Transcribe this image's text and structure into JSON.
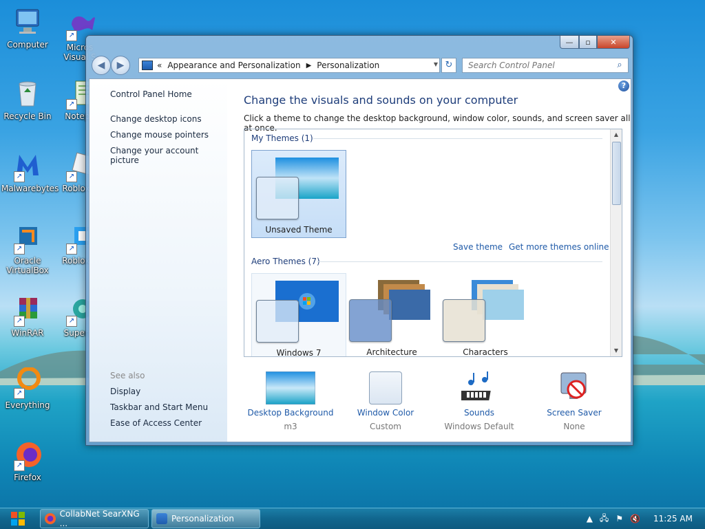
{
  "desktop": {
    "icons": [
      {
        "label": "Computer",
        "icon": "computer-icon"
      },
      {
        "label": "Micros\nVisual S",
        "icon": "visual-studio-icon"
      },
      {
        "label": "Recycle Bin",
        "icon": "recycle-bin-icon"
      },
      {
        "label": "Notepa",
        "icon": "notepad-icon"
      },
      {
        "label": "Malwarebytes",
        "icon": "malwarebytes-icon"
      },
      {
        "label": "Roblox P",
        "icon": "roblox-icon"
      },
      {
        "label": "Oracle\nVirtualBox",
        "icon": "virtualbox-icon"
      },
      {
        "label": "Roblox S",
        "icon": "roblox-studio-icon"
      },
      {
        "label": "WinRAR",
        "icon": "winrar-icon"
      },
      {
        "label": "Superm",
        "icon": "app-icon"
      },
      {
        "label": "Everything",
        "icon": "everything-icon"
      },
      {
        "label": "Firefox",
        "icon": "firefox-icon"
      }
    ]
  },
  "window": {
    "caption_buttons": {
      "minimize": "—",
      "maximize": "▫",
      "close": "✕"
    },
    "address": {
      "prefix": "«",
      "crumbs": [
        "Appearance and Personalization",
        "Personalization"
      ]
    },
    "search_placeholder": "Search Control Panel",
    "left_pane": {
      "home": "Control Panel Home",
      "links": [
        "Change desktop icons",
        "Change mouse pointers",
        "Change your account picture"
      ],
      "see_also_header": "See also",
      "see_also": [
        "Display",
        "Taskbar and Start Menu",
        "Ease of Access Center"
      ]
    },
    "main": {
      "title": "Change the visuals and sounds on your computer",
      "subtitle": "Click a theme to change the desktop background, window color, sounds, and screen saver all at once.",
      "my_themes_header": "My Themes (1)",
      "my_themes": [
        {
          "label": "Unsaved Theme",
          "selected": true
        }
      ],
      "save_theme": "Save theme",
      "get_more": "Get more themes online",
      "aero_header": "Aero Themes (7)",
      "aero_themes": [
        {
          "label": "Windows 7"
        },
        {
          "label": "Architecture"
        },
        {
          "label": "Characters"
        }
      ],
      "bottom_items": [
        {
          "caption": "Desktop Background",
          "value": "m3",
          "icon": "desktop-background-icon"
        },
        {
          "caption": "Window Color",
          "value": "Custom",
          "icon": "window-color-icon"
        },
        {
          "caption": "Sounds",
          "value": "Windows Default",
          "icon": "sounds-icon"
        },
        {
          "caption": "Screen Saver",
          "value": "None",
          "icon": "screen-saver-icon"
        }
      ]
    }
  },
  "taskbar": {
    "items": [
      {
        "label": "CollabNet SearXNG ...",
        "active": false
      },
      {
        "label": "Personalization",
        "active": true
      }
    ],
    "clock": "11:25 AM"
  }
}
